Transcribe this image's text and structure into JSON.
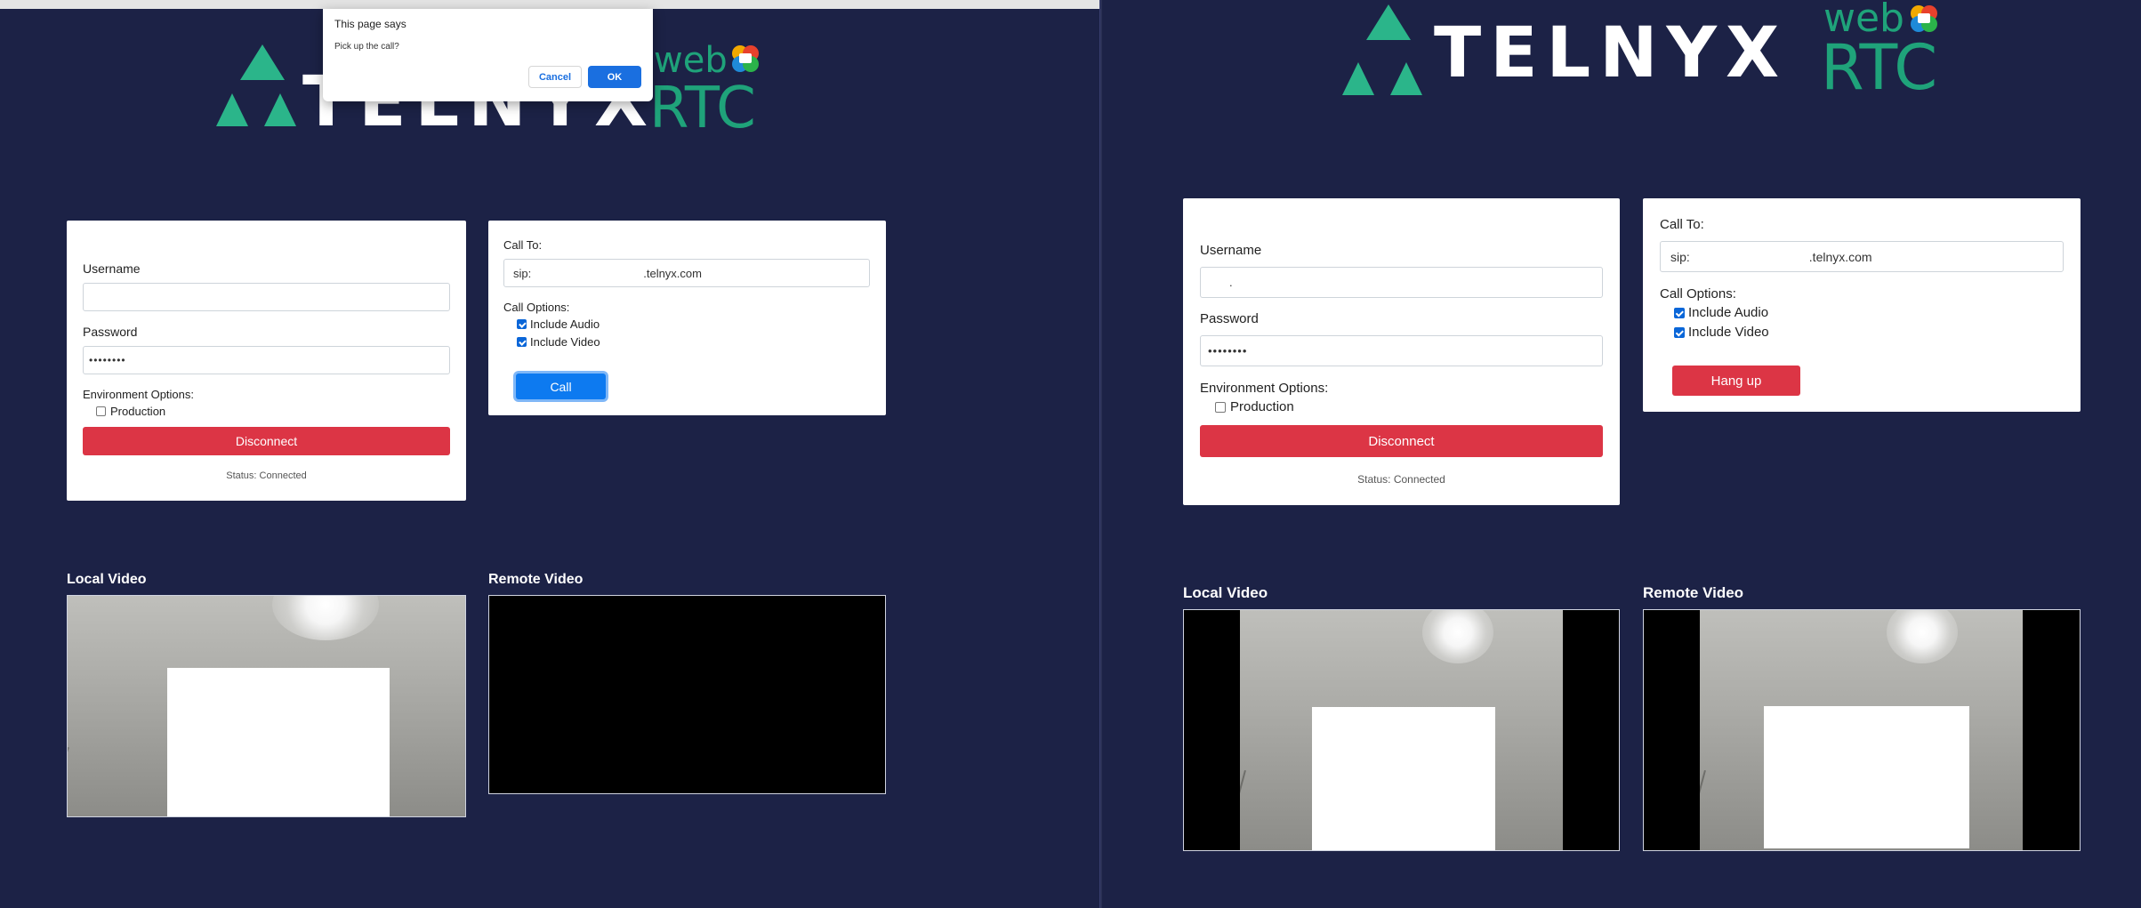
{
  "dialog": {
    "title": "This page says",
    "message": "Pick up the call?",
    "cancel_label": "Cancel",
    "ok_label": "OK"
  },
  "logo": {
    "brand": "TELNYX",
    "web": "web",
    "rtc": "RTC",
    "colors": {
      "triangle": "#2bb58a",
      "brand_text": "#ffffff",
      "rtc_text": "#1fa37a"
    }
  },
  "left": {
    "login": {
      "username_label": "Username",
      "username_value": "",
      "password_label": "Password",
      "password_value": "••••••••",
      "env_label": "Environment Options:",
      "production_label": "Production",
      "production_checked": false,
      "disconnect_label": "Disconnect",
      "status_text": "Status: Connected"
    },
    "call": {
      "call_to_label": "Call To:",
      "call_to_prefix": "sip:",
      "call_to_domain": ".telnyx.com",
      "options_label": "Call Options:",
      "audio_label": "Include Audio",
      "audio_checked": true,
      "video_label": "Include Video",
      "video_checked": true,
      "call_button_label": "Call"
    },
    "local_video_label": "Local Video",
    "remote_video_label": "Remote Video"
  },
  "right": {
    "login": {
      "username_label": "Username",
      "username_value": ".",
      "password_label": "Password",
      "password_value": "••••••••",
      "env_label": "Environment Options:",
      "production_label": "Production",
      "production_checked": false,
      "disconnect_label": "Disconnect",
      "status_text": "Status: Connected"
    },
    "call": {
      "call_to_label": "Call To:",
      "call_to_prefix": "sip:",
      "call_to_domain": ".telnyx.com",
      "options_label": "Call Options:",
      "audio_label": "Include Audio",
      "audio_checked": true,
      "video_label": "Include Video",
      "video_checked": true,
      "hangup_label": "Hang up"
    },
    "local_video_label": "Local Video",
    "remote_video_label": "Remote Video"
  },
  "colors": {
    "background": "#1c2246",
    "danger": "#dc3545",
    "primary": "#0d7af0"
  }
}
